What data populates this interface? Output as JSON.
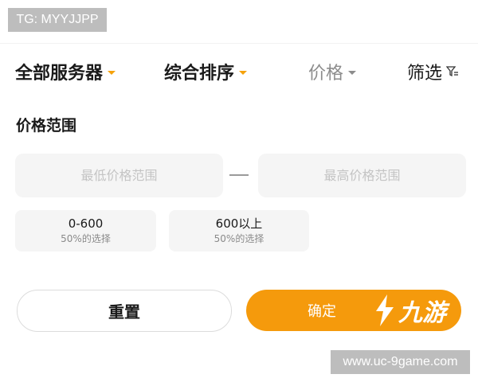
{
  "overlay": {
    "tg_label": "TG: MYYJJPP",
    "site_label": "www.uc-9game.com"
  },
  "filter_bar": {
    "tabs": [
      {
        "label": "全部服务器"
      },
      {
        "label": "综合排序"
      },
      {
        "label": "价格"
      },
      {
        "label": "筛选"
      }
    ]
  },
  "price_section": {
    "title": "价格范围",
    "min_placeholder": "最低价格范围",
    "max_placeholder": "最高价格范围",
    "presets": [
      {
        "range": "0-600",
        "share": "50%的选择"
      },
      {
        "range": "600以上",
        "share": "50%的选择"
      }
    ]
  },
  "actions": {
    "reset_label": "重置",
    "confirm_label": "确定"
  },
  "watermark": {
    "text": "九游"
  },
  "colors": {
    "accent": "#f59a0c",
    "muted": "#8c8c8c",
    "input_bg": "#f5f5f5"
  }
}
